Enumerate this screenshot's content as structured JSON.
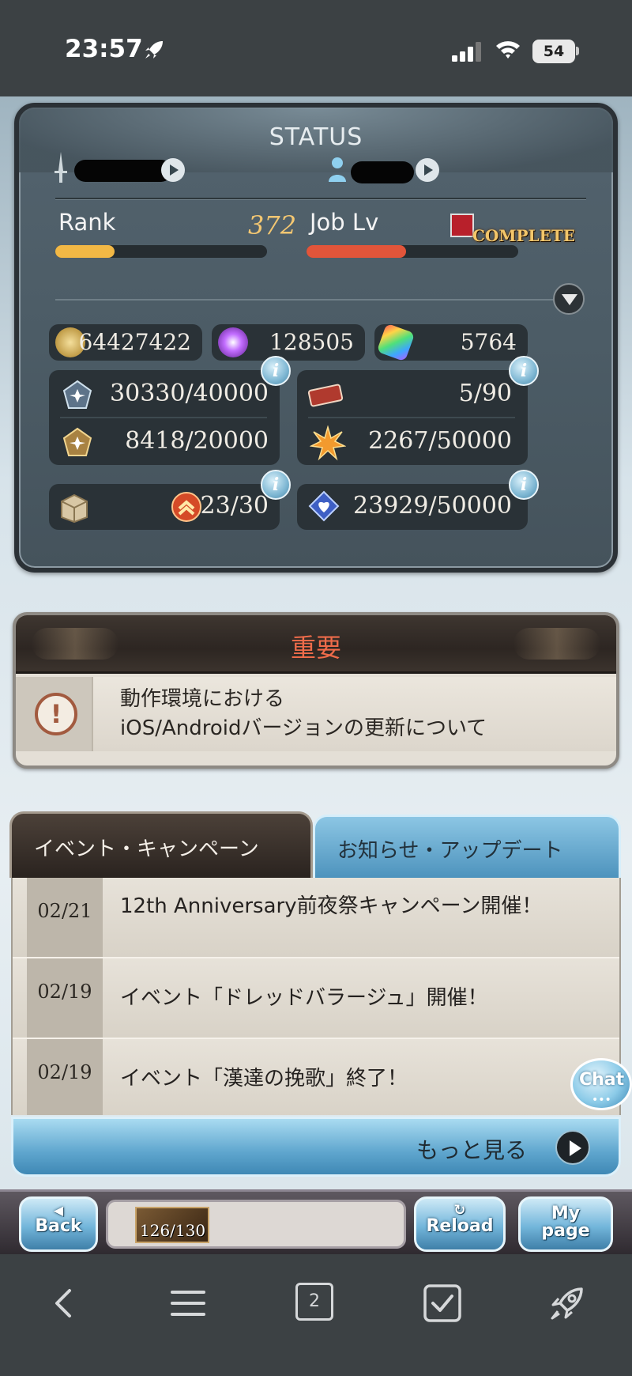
{
  "ios_status": {
    "time": "23:57",
    "battery": "54"
  },
  "status": {
    "title": "STATUS",
    "rank_label": "Rank",
    "rank_value": "372",
    "rank_progress": 0.28,
    "job_label": "Job Lv",
    "job_complete": "COMPLETE",
    "job_progress": 0.47,
    "currencies": [
      {
        "icon": "rupie-coin-icon",
        "value": "64427422"
      },
      {
        "icon": "crystal-icon",
        "value": "128505"
      },
      {
        "icon": "rainbow-prism-icon",
        "value": "5764"
      }
    ],
    "stats": [
      {
        "icon": "blue-gem-icon",
        "value": "30330/40000"
      },
      {
        "icon": "ticket-icon",
        "value": "5/90"
      },
      {
        "icon": "gold-gem-icon",
        "value": "8418/20000"
      },
      {
        "icon": "starburst-icon",
        "value": "2267/50000"
      },
      {
        "icon": "crate-icon",
        "value": "23/30"
      },
      {
        "icon": "heart-gem-icon",
        "value": "23929/50000"
      }
    ],
    "info_symbol": "i"
  },
  "important": {
    "title": "重要",
    "icon_symbol": "!",
    "notice_line1": "動作環境における",
    "notice_line2": "iOS/Androidバージョンの更新について"
  },
  "tabs": {
    "events": "イベント・キャンペーン",
    "news": "お知らせ・アップデート"
  },
  "news": [
    {
      "date": "02/21",
      "text": "12th Anniversary前夜祭キャンペーン開催！"
    },
    {
      "date": "02/19",
      "text": "イベント「ドレッドバラージュ」開催！"
    },
    {
      "date": "02/19",
      "text": "イベント「漢達の挽歌」終了！"
    }
  ],
  "more": {
    "label": "もっと見る"
  },
  "chat": {
    "label": "Chat",
    "dots": "•••"
  },
  "footer": {
    "back": "Back",
    "stamina": "126/130",
    "reload": "Reload",
    "mypage_line1": "My",
    "mypage_line2": "page"
  },
  "browser": {
    "tab_count": "2"
  },
  "colors": {
    "rank_bar": "#f2b845",
    "job_bar": "#e2553a",
    "important_title": "#ee6b4a",
    "accent_blue": "#4d93bd"
  }
}
